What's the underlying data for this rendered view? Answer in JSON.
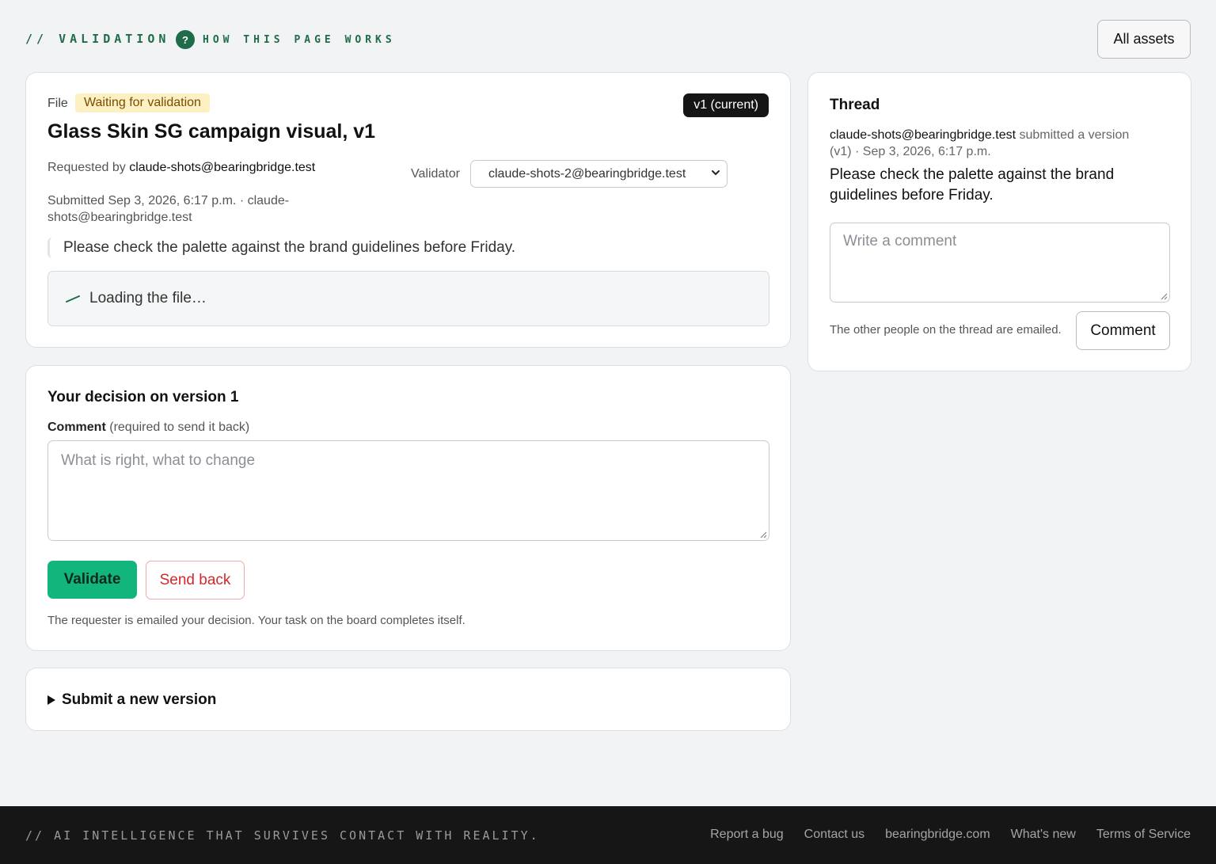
{
  "header": {
    "crumb": "// VALIDATION",
    "how_icon": "?",
    "how_label": "HOW THIS PAGE WORKS",
    "all_assets": "All assets"
  },
  "file": {
    "label": "File",
    "status_badge": "Waiting for validation",
    "version_pill": "v1 (current)",
    "title": "Glass Skin SG campaign visual, v1",
    "requested_by_label": "Requested by",
    "requested_by": "claude-shots@bearingbridge.test",
    "submitted_label": "Submitted Sep 3, 2026, 6:17 p.m. · claude-",
    "submitted_line2": "shots@bearingbridge.test",
    "validator_label": "Validator",
    "validator_value": "claude-shots-2@bearingbridge.test",
    "quote": "Please check the palette against the brand guidelines before Friday.",
    "loading_text": "Loading the file…"
  },
  "decision": {
    "title": "Your decision on version 1",
    "comment_label": "Comment",
    "comment_hint": "(required to send it back)",
    "placeholder": "What is right, what to change",
    "validate": "Validate",
    "send_back": "Send back",
    "help": "The requester is emailed your decision. Your task on the board completes itself."
  },
  "submit": {
    "summary": "Submit a new version"
  },
  "thread": {
    "title": "Thread",
    "author": "claude-shots@bearingbridge.test",
    "action": "submitted a version",
    "meta": "(v1) · Sep 3, 2026, 6:17 p.m.",
    "message": "Please check the palette against the brand guidelines before Friday.",
    "placeholder": "Write a comment",
    "help": "The other people on the thread are emailed.",
    "comment_button": "Comment"
  },
  "footer": {
    "tagline": "// AI INTELLIGENCE THAT SURVIVES CONTACT WITH REALITY.",
    "links": [
      "Report a bug",
      "Contact us",
      "bearingbridge.com",
      "What's new",
      "Terms of Service"
    ]
  },
  "colors": {
    "accent": "#1f6b4a",
    "validate": "#12b57b",
    "send_back": "#d12a2a",
    "badge": "#fdf0c2"
  }
}
